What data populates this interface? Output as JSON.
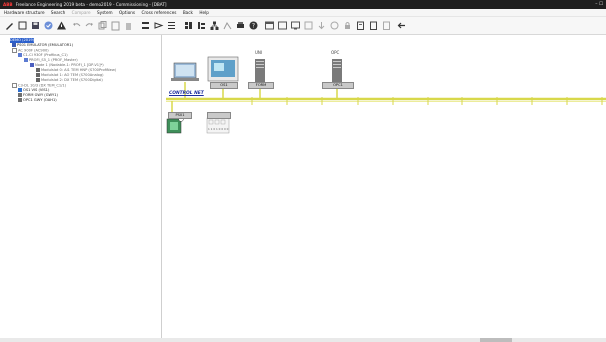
{
  "title": {
    "logo": "ABB",
    "text": "Freelance Engineering 2019 beta - demo2019 - Commissioning - [DBAT]",
    "window_controls": "–  ☐"
  },
  "menu": {
    "items": [
      "Hardware structure",
      "Search",
      "Compare",
      "System",
      "Options",
      "Cross references",
      "Back",
      "Help"
    ],
    "disabled": [
      "Compare"
    ]
  },
  "toolbar": {
    "icons": [
      "pencil-icon",
      "new-doc-icon",
      "save-icon",
      "check-icon",
      "warning-icon",
      "undo-icon",
      "redo-icon",
      "copy-icon",
      "paste-icon",
      "delete-icon",
      "hierarchy-icon",
      "indent-icon",
      "list-icon",
      "grid-icon",
      "tree-icon",
      "network-icon",
      "connect-icon",
      "print-icon",
      "help-icon",
      "window-icon",
      "screen-icon",
      "monitor-icon",
      "panel-icon",
      "import-icon",
      "refresh-icon",
      "lock-icon",
      "docs-icon",
      "report-icon",
      "export-icon",
      "back-arrow-icon"
    ]
  },
  "tree": {
    "items": [
      {
        "label": "DEMO (2019)",
        "level": 1,
        "selected": true
      },
      {
        "label": "PS01 EMULATOR (EMULATOR1)",
        "level": 2
      },
      {
        "label": "AC 900F (AC900)",
        "level": 2
      },
      {
        "label": "C1-CI 930F (Profibus_C1)",
        "level": 3
      },
      {
        "label": "PROFI_S5_1 (PROF_Master)",
        "level": 4
      },
      {
        "label": "Node 1 (Nodable-1: PROFI_1 [DP-V1]*)",
        "level": 5
      },
      {
        "label": "Modulslot 0: Al1 TEM HNP (S700ProfiNew)",
        "level": 6
      },
      {
        "label": "Modulslot 1: AO TEM (S700Analog)",
        "level": 6
      },
      {
        "label": "Modulslot 2: DX TEM (S700Digital)",
        "level": 6
      },
      {
        "label": "C3-DL 10/3 (DX TEM_C1/1)",
        "level": 3
      },
      {
        "label": "OS1 VIS (VIS1)",
        "level": 2
      },
      {
        "label": "FORM GWY (GWY1)",
        "level": 2
      },
      {
        "label": "OPC1 GWY (OAH1)",
        "level": 2
      }
    ]
  },
  "network": {
    "name": "CONTROL NET",
    "stations": [
      {
        "top_label": "",
        "label": "",
        "kind": "laptop"
      },
      {
        "top_label": "",
        "label": "OS1",
        "kind": "operator-station"
      },
      {
        "top_label": "UNI",
        "label": "FORM",
        "kind": "gateway"
      },
      {
        "top_label": "OPC",
        "label": "OPC1",
        "kind": "gateway"
      }
    ],
    "controller": {
      "label": "PS01",
      "tag": "PS01"
    },
    "module_box": {
      "header": "",
      "text": "1 1 0 1 0 0 0 0"
    }
  },
  "colors": {
    "network_line": "#d8d84a",
    "selection": "#2b5fcc",
    "title_bg": "#1f1f1f"
  }
}
